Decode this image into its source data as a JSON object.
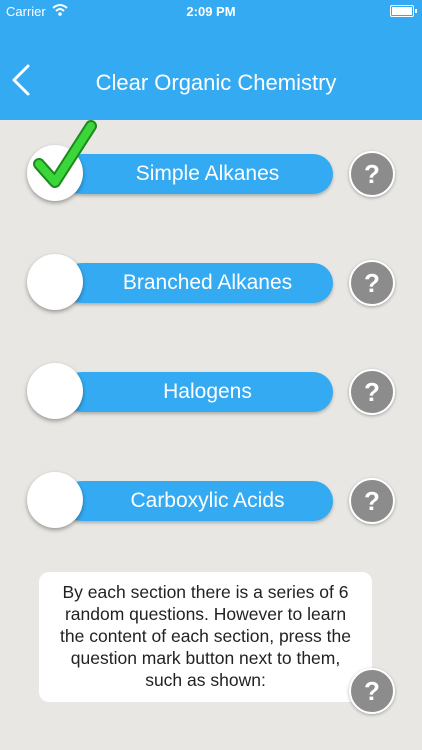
{
  "status_bar": {
    "carrier": "Carrier",
    "time": "2:09 PM",
    "wifi_icon": "wifi-icon",
    "battery_icon": "battery-icon"
  },
  "nav": {
    "title": "Clear Organic Chemistry",
    "back_icon": "chevron-left-icon"
  },
  "sections": [
    {
      "label": "Simple Alkanes",
      "checked": true
    },
    {
      "label": "Branched Alkanes",
      "checked": false
    },
    {
      "label": "Halogens",
      "checked": false
    },
    {
      "label": "Carboxylic Acids",
      "checked": false
    }
  ],
  "help_symbol": "?",
  "info_text": "By each section there is a series of 6 random questions. However to learn the content of each section, press the question mark button next to them, such as shown:",
  "colors": {
    "accent": "#34aaf3",
    "background": "#e8e7e3",
    "help_button": "#8c8c8c",
    "check": "#3ad63a"
  }
}
